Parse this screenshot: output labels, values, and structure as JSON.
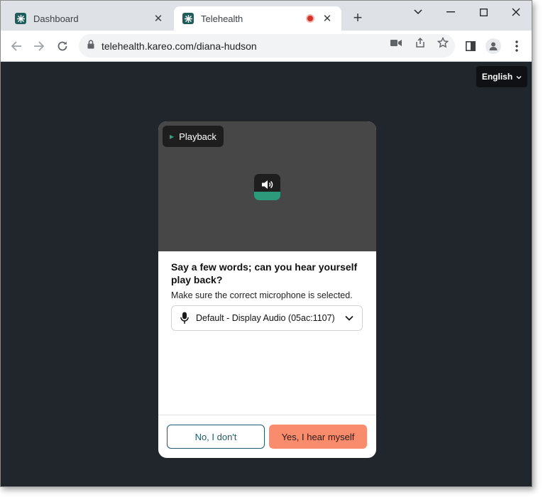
{
  "tabs": [
    {
      "label": "Dashboard",
      "active": false
    },
    {
      "label": "Telehealth",
      "active": true,
      "recording": true
    }
  ],
  "address_bar": {
    "url": "telehealth.kareo.com/diana-hudson"
  },
  "language": {
    "selected": "English"
  },
  "modal": {
    "playback_label": "Playback",
    "heading": "Say a few words; can you hear yourself play back?",
    "subtext": "Make sure the correct microphone is selected.",
    "microphone": {
      "selected": "Default - Display Audio (05ac:1107)"
    },
    "no_button": "No, I don't",
    "yes_button": "Yes, I hear myself"
  },
  "colors": {
    "page_bg": "#21262c",
    "accent_teal": "#2e9a7c",
    "primary_button": "#fa8c6e",
    "secondary_border": "#1f5c6b"
  },
  "icons": {
    "tab_favicon": "kareo-icon",
    "record": "recording-dot-icon",
    "speaker": "speaker-icon",
    "microphone": "microphone-icon"
  }
}
